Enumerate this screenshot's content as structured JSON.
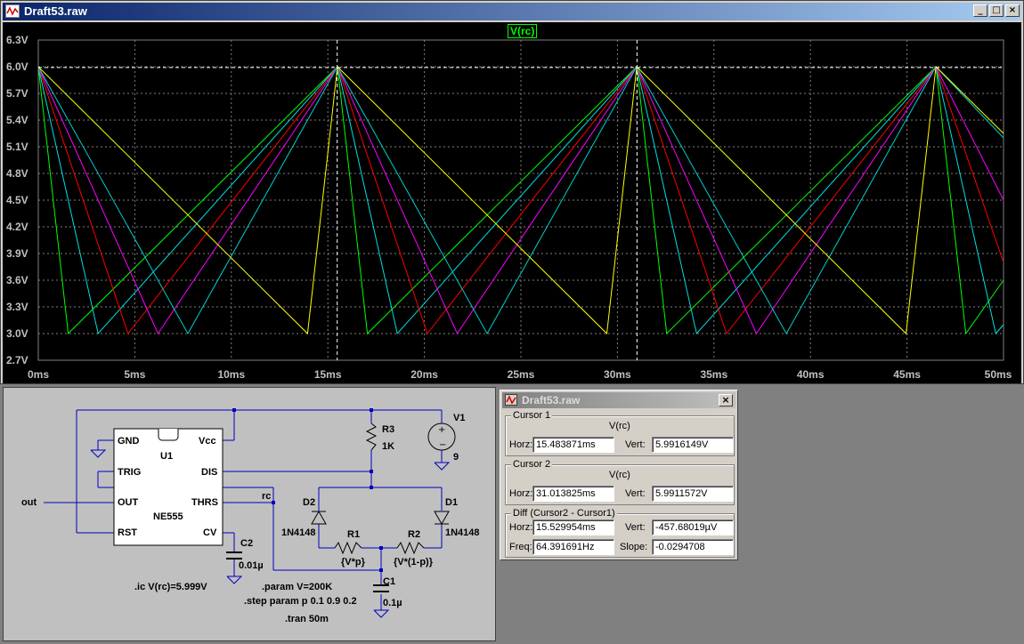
{
  "window": {
    "title": "Draft53.raw",
    "minimize": "_",
    "maximize": "□",
    "close": "×"
  },
  "plot": {
    "trace_label": "V(rc)",
    "y_ticks": [
      "6.3V",
      "6.0V",
      "5.7V",
      "5.4V",
      "5.1V",
      "4.8V",
      "4.5V",
      "4.2V",
      "3.9V",
      "3.6V",
      "3.3V",
      "3.0V",
      "2.7V"
    ],
    "x_ticks": [
      "0ms",
      "5ms",
      "10ms",
      "15ms",
      "20ms",
      "25ms",
      "30ms",
      "35ms",
      "40ms",
      "45ms",
      "50ms"
    ]
  },
  "chart_data": {
    "type": "line",
    "xlabel": "",
    "ylabel": "",
    "xlim": [
      0,
      50
    ],
    "ylim": [
      2.7,
      6.3
    ],
    "x_unit": "ms",
    "y_unit": "V",
    "grid": true,
    "cursors_x": [
      15.483871,
      31.013825
    ],
    "series": [
      {
        "color": "#00ff00",
        "points": [
          [
            0,
            6.0
          ],
          [
            1.55,
            3.0
          ],
          [
            15.5,
            6.0
          ],
          [
            17.05,
            3.0
          ],
          [
            31.0,
            6.0
          ],
          [
            32.55,
            3.0
          ],
          [
            46.5,
            6.0
          ],
          [
            48.05,
            3.0
          ],
          [
            50,
            3.6
          ]
        ]
      },
      {
        "color": "#00e0e0",
        "points": [
          [
            0,
            6.0
          ],
          [
            3.1,
            3.0
          ],
          [
            15.5,
            6.0
          ],
          [
            18.6,
            3.0
          ],
          [
            31.0,
            6.0
          ],
          [
            34.1,
            3.0
          ],
          [
            46.5,
            6.0
          ],
          [
            49.6,
            3.0
          ],
          [
            50,
            3.1
          ]
        ]
      },
      {
        "color": "#ff0000",
        "points": [
          [
            0,
            6.0
          ],
          [
            4.65,
            3.0
          ],
          [
            15.5,
            6.0
          ],
          [
            20.15,
            3.0
          ],
          [
            31.0,
            6.0
          ],
          [
            35.65,
            3.0
          ],
          [
            46.5,
            6.0
          ],
          [
            50,
            3.8
          ]
        ]
      },
      {
        "color": "#ff00ff",
        "points": [
          [
            0,
            6.0
          ],
          [
            6.2,
            3.0
          ],
          [
            15.5,
            6.0
          ],
          [
            21.7,
            3.0
          ],
          [
            31.0,
            6.0
          ],
          [
            37.2,
            3.0
          ],
          [
            46.5,
            6.0
          ],
          [
            50,
            4.5
          ]
        ]
      },
      {
        "color": "#00d0d0",
        "points": [
          [
            0,
            6.0
          ],
          [
            7.75,
            3.0
          ],
          [
            15.5,
            6.0
          ],
          [
            23.25,
            3.0
          ],
          [
            31.0,
            6.0
          ],
          [
            38.75,
            3.0
          ],
          [
            46.5,
            6.0
          ],
          [
            50,
            5.2
          ]
        ]
      },
      {
        "color": "#ffff00",
        "points": [
          [
            0,
            6.0
          ],
          [
            13.95,
            3.0
          ],
          [
            15.5,
            6.0
          ],
          [
            29.45,
            3.0
          ],
          [
            31.0,
            6.0
          ],
          [
            44.95,
            3.0
          ],
          [
            46.5,
            6.0
          ],
          [
            50,
            5.25
          ]
        ]
      }
    ]
  },
  "cursor_window": {
    "title": "Draft53.raw",
    "close": "×",
    "cursor1": {
      "group": "Cursor 1",
      "trace": "V(rc)",
      "horz_label": "Horz:",
      "horz": "15.483871ms",
      "vert_label": "Vert:",
      "vert": "5.9916149V"
    },
    "cursor2": {
      "group": "Cursor 2",
      "trace": "V(rc)",
      "horz_label": "Horz:",
      "horz": "31.013825ms",
      "vert_label": "Vert:",
      "vert": "5.9911572V"
    },
    "diff": {
      "group": "Diff (Cursor2 - Cursor1)",
      "horz_label": "Horz:",
      "horz": "15.529954ms",
      "vert_label": "Vert:",
      "vert": "-457.68019µV",
      "freq_label": "Freq:",
      "freq": "64.391691Hz",
      "slope_label": "Slope:",
      "slope": "-0.0294708"
    }
  },
  "schematic": {
    "gnd": "GND",
    "vcc": "Vcc",
    "u1": "U1",
    "trig": "TRIG",
    "dis": "DIS",
    "out_pin": "OUT",
    "thrs": "THRS",
    "ne555": "NE555",
    "rst": "RST",
    "cv": "CV",
    "out_net": "out",
    "rc_net": "rc",
    "r3": "R3",
    "r3_val": "1K",
    "v1": "V1",
    "v1_val": "9",
    "d2": "D2",
    "d2_val": "1N4148",
    "d1": "D1",
    "d1_val": "1N4148",
    "r1": "R1",
    "r1_val": "{V*p}",
    "r2": "R2",
    "r2_val": "{V*(1-p)}",
    "c1": "C1",
    "c1_val": "0.1µ",
    "c2": "C2",
    "c2_val": "0.01µ",
    "ic": ".ic V(rc)=5.999V",
    "param": ".param V=200K",
    "step": ".step param p 0.1 0.9 0.2",
    "tran": ".tran 50m"
  }
}
